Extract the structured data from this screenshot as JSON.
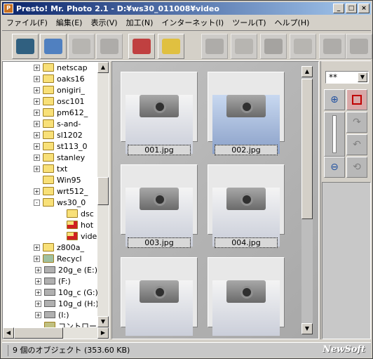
{
  "window": {
    "title": "Presto! Mr. Photo 2.1 - D:¥ws30_011008¥video",
    "controls": [
      "_",
      "□",
      "×"
    ]
  },
  "menubar": {
    "items": [
      "ファイル(F)",
      "編集(E)",
      "表示(V)",
      "加工(N)",
      "インターネット(I)",
      "ツール(T)",
      "ヘルプ(H)"
    ]
  },
  "toolbar": {
    "buttons": [
      {
        "icon": "camera-icon",
        "enabled": true
      },
      {
        "icon": "scanner-icon",
        "enabled": true
      },
      {
        "icon": "import-icon",
        "enabled": false
      },
      {
        "icon": "box-icon",
        "enabled": false
      },
      {
        "icon": "magnify-photo-icon",
        "enabled": true
      },
      {
        "icon": "folder-icon",
        "enabled": true
      },
      {
        "icon": "edit-photo-icon",
        "enabled": false
      },
      {
        "icon": "paint-icon",
        "enabled": false
      },
      {
        "icon": "film-reel-icon",
        "enabled": false
      },
      {
        "icon": "printer-icon",
        "enabled": false
      },
      {
        "icon": "tape-icon",
        "enabled": false
      },
      {
        "icon": "webcam-icon",
        "enabled": false
      }
    ]
  },
  "tree": {
    "items": [
      {
        "label": "netscap",
        "level": 1,
        "type": "folder",
        "expander": "+"
      },
      {
        "label": "oaks16",
        "level": 1,
        "type": "folder",
        "expander": "+"
      },
      {
        "label": "onigiri_",
        "level": 1,
        "type": "folder",
        "expander": "+"
      },
      {
        "label": "osc101",
        "level": 1,
        "type": "folder",
        "expander": "+"
      },
      {
        "label": "pm612_",
        "level": 1,
        "type": "folder",
        "expander": "+"
      },
      {
        "label": "s-and-",
        "level": 1,
        "type": "folder",
        "expander": "+"
      },
      {
        "label": "sl1202",
        "level": 1,
        "type": "folder",
        "expander": "+"
      },
      {
        "label": "st113_0",
        "level": 1,
        "type": "folder",
        "expander": "+"
      },
      {
        "label": "stanley",
        "level": 1,
        "type": "folder",
        "expander": "+"
      },
      {
        "label": "txt",
        "level": 1,
        "type": "folder",
        "expander": "+"
      },
      {
        "label": "Win95",
        "level": 1,
        "type": "folder",
        "expander": ""
      },
      {
        "label": "wrt512_",
        "level": 1,
        "type": "folder",
        "expander": "+"
      },
      {
        "label": "ws30_0",
        "level": 1,
        "type": "folder",
        "expander": "-"
      },
      {
        "label": "dsc",
        "level": 2,
        "type": "folder",
        "expander": ""
      },
      {
        "label": "hot",
        "level": 2,
        "type": "folder-special",
        "expander": ""
      },
      {
        "label": "vide",
        "level": 2,
        "type": "folder-special",
        "expander": ""
      },
      {
        "label": "z800a_",
        "level": 1,
        "type": "folder",
        "expander": "+"
      },
      {
        "label": "Recycl",
        "level": 1,
        "type": "recycle",
        "expander": "+"
      },
      {
        "label": "20g_e (E:)",
        "level": 0,
        "type": "drive",
        "expander": "+"
      },
      {
        "label": "(F:)",
        "level": 0,
        "type": "drive",
        "expander": "+"
      },
      {
        "label": "10g_c (G:)",
        "level": 0,
        "type": "drive",
        "expander": "+"
      },
      {
        "label": "10g_d (H:)",
        "level": 0,
        "type": "drive",
        "expander": "+"
      },
      {
        "label": "(I:)",
        "level": 0,
        "type": "drive",
        "expander": "+"
      },
      {
        "label": "コントロール パ",
        "level": 0,
        "type": "control-panel",
        "expander": ""
      }
    ]
  },
  "gallery": {
    "thumbnails": [
      {
        "filename": "001.jpg",
        "style": "plain"
      },
      {
        "filename": "002.jpg",
        "style": "blue"
      },
      {
        "filename": "003.jpg",
        "style": "plain"
      },
      {
        "filename": "004.jpg",
        "style": "plain"
      },
      {
        "filename": "",
        "style": "plain"
      },
      {
        "filename": "",
        "style": "plain"
      }
    ]
  },
  "rightpanel": {
    "zoom_value": "**",
    "buttons": [
      "zoom-in-icon",
      "select-rect-icon",
      "redo-icon",
      "undo-icon",
      "zoom-out-icon",
      "rotate-icon"
    ]
  },
  "statusbar": {
    "text": "9 個のオブジェクト (353.60 KB)",
    "brand": "NewSoft"
  },
  "colors": {
    "titlebar_start": "#0a246a",
    "titlebar_end": "#a6caf0",
    "folder": "#f8e078"
  }
}
